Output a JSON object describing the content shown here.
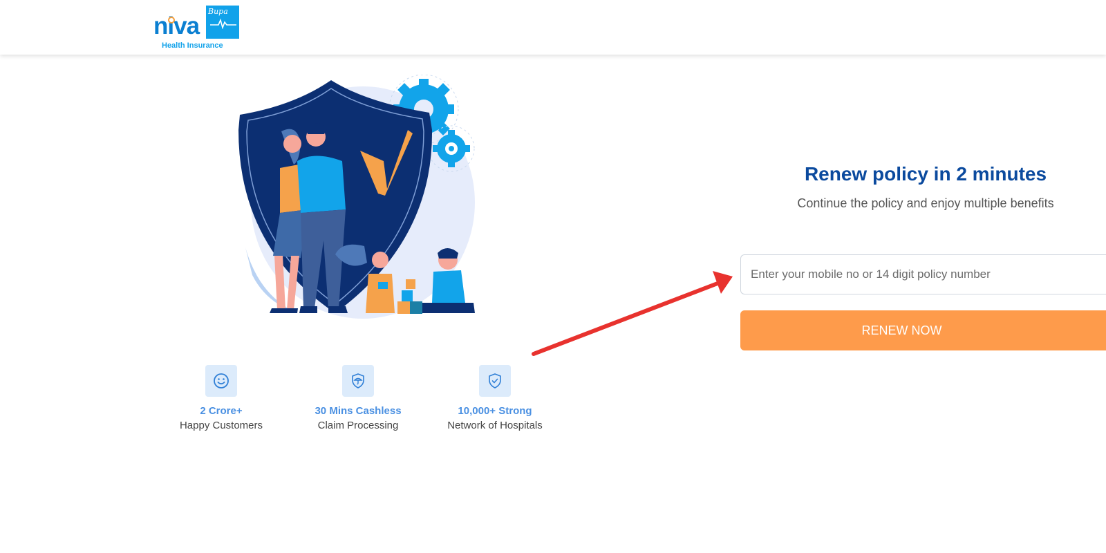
{
  "header": {
    "logo": {
      "wordmark": "niva",
      "badge": "Bupa",
      "tagline": "Health Insurance"
    }
  },
  "features": [
    {
      "icon": "smiley-icon",
      "title": "2 Crore+",
      "subtitle": "Happy Customers"
    },
    {
      "icon": "shield-umbrella-icon",
      "title": "30 Mins Cashless",
      "subtitle": "Claim Processing"
    },
    {
      "icon": "shield-check-icon",
      "title": "10,000+ Strong",
      "subtitle": "Network of Hospitals"
    }
  ],
  "renew": {
    "headline": "Renew policy in 2 minutes",
    "subhead": "Continue the policy and enjoy multiple benefits",
    "input_placeholder": "Enter your mobile no or 14 digit policy number",
    "input_value": "",
    "button_label": "RENEW NOW"
  },
  "colors": {
    "brand_blue": "#0b4a9e",
    "accent_blue": "#4a90e2",
    "button_orange": "#fe9b4b",
    "annotation_red": "#e8322e"
  }
}
